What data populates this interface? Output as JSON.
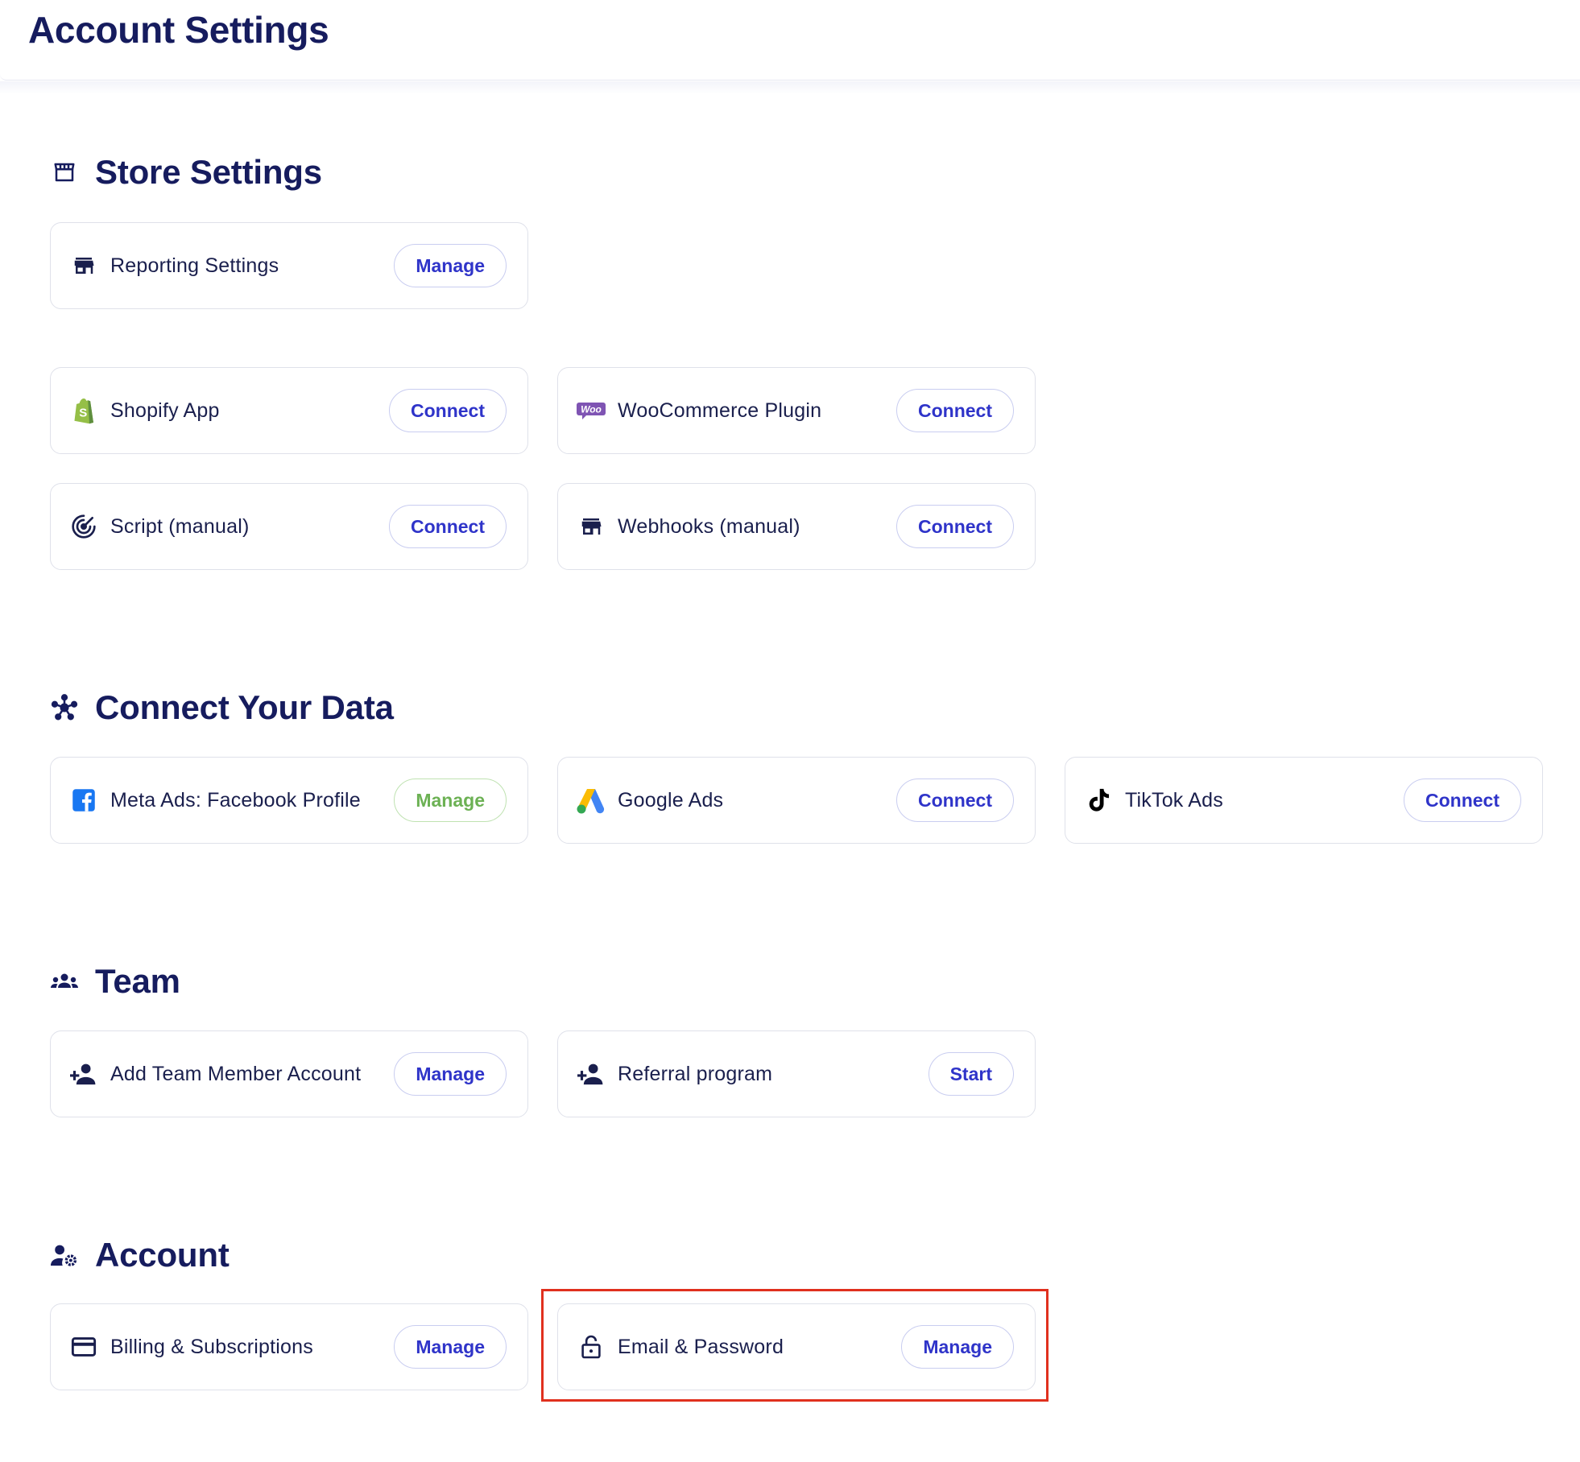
{
  "page": {
    "title": "Account Settings"
  },
  "colors": {
    "accent": "#2f34c9",
    "heading": "#161c5e",
    "manage_green": "#6cb154",
    "highlight": "#e0301e"
  },
  "sections": {
    "store": {
      "title": "Store Settings",
      "icon": "storefront-icon",
      "items": [
        {
          "label": "Reporting Settings",
          "button": "Manage",
          "icon": "store-icon"
        },
        {
          "label": "Shopify App",
          "button": "Connect",
          "icon": "shopify-icon"
        },
        {
          "label": "WooCommerce Plugin",
          "button": "Connect",
          "icon": "woocommerce-icon",
          "icon_text": "Woo"
        },
        {
          "label": "Script (manual)",
          "button": "Connect",
          "icon": "radar-icon"
        },
        {
          "label": "Webhooks (manual)",
          "button": "Connect",
          "icon": "store-icon"
        }
      ]
    },
    "data": {
      "title": "Connect Your Data",
      "icon": "hub-icon",
      "items": [
        {
          "label": "Meta Ads: Facebook Profile",
          "button": "Manage",
          "icon": "facebook-icon",
          "button_color": "green"
        },
        {
          "label": "Google Ads",
          "button": "Connect",
          "icon": "google-ads-icon"
        },
        {
          "label": "TikTok Ads",
          "button": "Connect",
          "icon": "tiktok-icon"
        }
      ]
    },
    "team": {
      "title": "Team",
      "icon": "groups-icon",
      "items": [
        {
          "label": "Add Team Member Account",
          "button": "Manage",
          "icon": "person-add-icon"
        },
        {
          "label": "Referral program",
          "button": "Start",
          "icon": "person-add-icon"
        }
      ]
    },
    "account": {
      "title": "Account",
      "icon": "manage-accounts-icon",
      "items": [
        {
          "label": "Billing & Subscriptions",
          "button": "Manage",
          "icon": "credit-card-icon"
        },
        {
          "label": "Email & Password",
          "button": "Manage",
          "icon": "lock-icon",
          "highlighted": true
        }
      ]
    }
  }
}
